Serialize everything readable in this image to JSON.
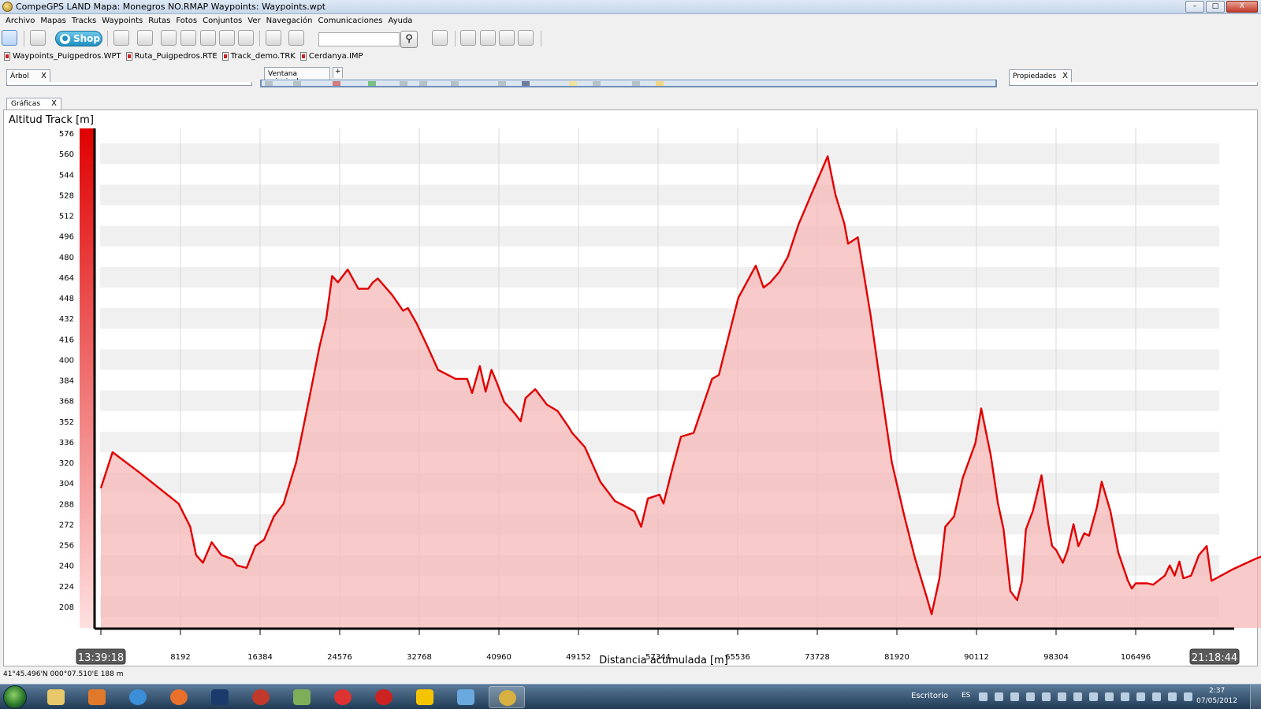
{
  "window": {
    "title": "CompeGPS LAND Mapa: Monegros NO.RMAP Waypoints: Waypoints.wpt",
    "min_label": "–",
    "max_label": "□",
    "close_label": "X"
  },
  "menu": [
    "Archivo",
    "Mapas",
    "Tracks",
    "Waypoints",
    "Rutas",
    "Fotos",
    "Conjuntos",
    "Ver",
    "Navegación",
    "Comunicaciones",
    "Ayuda"
  ],
  "toolbar": {
    "shop_label": "Shop",
    "search_value": "",
    "search_placeholder": ""
  },
  "files": [
    "Waypoints_Puigpedros.WPT",
    "Ruta_Puigpedros.RTE",
    "Track_demo.TRK",
    "Cerdanya.IMP"
  ],
  "panes": {
    "tree_tab": "Árbol",
    "main_tab": "Ventana principal",
    "add_tab": "+",
    "properties_tab": "Propiedades",
    "graphs_tab": "Gráficas",
    "close_label": "X"
  },
  "status": {
    "coords": "41°45.496'N 000°07.510'E  188 m"
  },
  "taskbar": {
    "escritorio": "Escritorio",
    "lang": "ES",
    "time": "2:37",
    "date": "07/05/2012"
  },
  "colors": {
    "track_line": "#e10000",
    "track_fill": "#f7b8b8",
    "band_dark": "#f0f0f0",
    "band_light": "#ffffff"
  },
  "chart_data": {
    "type": "area",
    "title": "Altitud Track [m]",
    "xlabel": "Distancia acumulada [m]",
    "ylabel": "",
    "start_time": "13:39:18",
    "end_time": "21:18:44",
    "xlim": [
      0,
      112000
    ],
    "ylim": [
      200,
      580
    ],
    "yticks": [
      208,
      224,
      240,
      256,
      272,
      288,
      304,
      320,
      336,
      352,
      368,
      384,
      400,
      416,
      432,
      448,
      464,
      480,
      496,
      512,
      528,
      544,
      560,
      576
    ],
    "xticks": [
      8192,
      16384,
      24576,
      32768,
      40960,
      49152,
      57344,
      65536,
      73728,
      81920,
      90112,
      98304,
      106496
    ],
    "grid": "horizontal bands",
    "series": [
      {
        "points": [
          [
            0,
            300
          ],
          [
            1200,
            328
          ],
          [
            4000,
            312
          ],
          [
            8000,
            288
          ],
          [
            9200,
            270
          ],
          [
            9800,
            248
          ],
          [
            10500,
            242
          ],
          [
            11400,
            258
          ],
          [
            12400,
            248
          ],
          [
            13500,
            245
          ],
          [
            14000,
            240
          ],
          [
            15000,
            238
          ],
          [
            15900,
            255
          ],
          [
            16800,
            260
          ],
          [
            17800,
            278
          ],
          [
            18800,
            288
          ],
          [
            20100,
            320
          ],
          [
            21500,
            372
          ],
          [
            22500,
            410
          ],
          [
            23200,
            432
          ],
          [
            23800,
            465
          ],
          [
            24400,
            460
          ],
          [
            25400,
            470
          ],
          [
            26500,
            455
          ],
          [
            27500,
            455
          ],
          [
            28000,
            460
          ],
          [
            28500,
            463
          ],
          [
            30000,
            450
          ],
          [
            31100,
            438
          ],
          [
            31600,
            440
          ],
          [
            32500,
            428
          ],
          [
            33500,
            412
          ],
          [
            34700,
            392
          ],
          [
            36500,
            385
          ],
          [
            37700,
            385
          ],
          [
            38200,
            374
          ],
          [
            39000,
            395
          ],
          [
            39600,
            375
          ],
          [
            40200,
            392
          ],
          [
            40700,
            383
          ],
          [
            41500,
            367
          ],
          [
            42600,
            358
          ],
          [
            43200,
            352
          ],
          [
            43700,
            370
          ],
          [
            44700,
            377
          ],
          [
            45900,
            365
          ],
          [
            47000,
            360
          ],
          [
            48100,
            348
          ],
          [
            48500,
            343
          ],
          [
            49800,
            332
          ],
          [
            51400,
            305
          ],
          [
            52900,
            290
          ],
          [
            53700,
            287
          ],
          [
            54900,
            282
          ],
          [
            55600,
            270
          ],
          [
            56300,
            292
          ],
          [
            57500,
            295
          ],
          [
            57900,
            288
          ],
          [
            58800,
            315
          ],
          [
            59700,
            340
          ],
          [
            61000,
            343
          ],
          [
            62900,
            385
          ],
          [
            63600,
            388
          ],
          [
            65600,
            448
          ],
          [
            67400,
            473
          ],
          [
            68200,
            456
          ],
          [
            68900,
            460
          ],
          [
            69800,
            468
          ],
          [
            70700,
            480
          ],
          [
            71800,
            505
          ],
          [
            73200,
            530
          ],
          [
            74800,
            558
          ],
          [
            75600,
            528
          ],
          [
            76500,
            506
          ],
          [
            76900,
            490
          ],
          [
            77900,
            495
          ],
          [
            79200,
            435
          ],
          [
            80200,
            382
          ],
          [
            81400,
            320
          ],
          [
            82700,
            278
          ],
          [
            83800,
            245
          ],
          [
            85000,
            215
          ],
          [
            85500,
            202
          ],
          [
            86300,
            230
          ],
          [
            86900,
            270
          ],
          [
            87800,
            278
          ],
          [
            88700,
            308
          ],
          [
            90000,
            335
          ],
          [
            90600,
            362
          ],
          [
            91600,
            325
          ],
          [
            92300,
            289
          ],
          [
            92900,
            268
          ],
          [
            93600,
            220
          ],
          [
            94300,
            213
          ],
          [
            94800,
            228
          ],
          [
            95200,
            268
          ],
          [
            95900,
            282
          ],
          [
            96800,
            310
          ],
          [
            97500,
            272
          ],
          [
            97900,
            255
          ],
          [
            98300,
            252
          ],
          [
            99000,
            242
          ],
          [
            99500,
            252
          ],
          [
            100100,
            272
          ],
          [
            100600,
            255
          ],
          [
            101200,
            265
          ],
          [
            101700,
            263
          ],
          [
            102500,
            285
          ],
          [
            103000,
            305
          ],
          [
            103900,
            282
          ],
          [
            104700,
            250
          ],
          [
            105700,
            228
          ],
          [
            106100,
            222
          ],
          [
            106500,
            226
          ],
          [
            107700,
            226
          ],
          [
            108300,
            225
          ],
          [
            109500,
            232
          ],
          [
            110000,
            240
          ],
          [
            110500,
            232
          ],
          [
            111000,
            243
          ],
          [
            111400,
            230
          ],
          [
            112200,
            232
          ],
          [
            113000,
            248
          ],
          [
            113800,
            255
          ],
          [
            114300,
            228
          ],
          [
            116500,
            237
          ],
          [
            118800,
            245
          ],
          [
            121200,
            252
          ],
          [
            122500,
            253
          ]
        ]
      }
    ]
  }
}
